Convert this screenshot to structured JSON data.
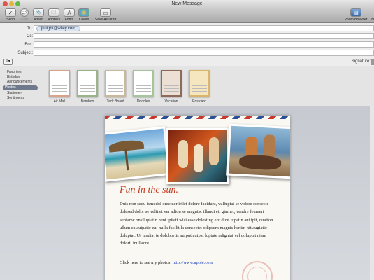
{
  "window": {
    "title": "New Message"
  },
  "toolbar": {
    "buttons": [
      {
        "label": "Send",
        "icon": "send-icon",
        "glyph": "✓"
      },
      {
        "label": "Chat",
        "icon": "chat-icon",
        "glyph": "💬"
      },
      {
        "label": "Attach",
        "icon": "paperclip-icon",
        "glyph": "📎"
      },
      {
        "label": "Address",
        "icon": "address-book-icon",
        "glyph": "📖"
      },
      {
        "label": "Fonts",
        "icon": "fonts-icon",
        "glyph": "A"
      },
      {
        "label": "Colors",
        "icon": "colors-icon",
        "glyph": "●"
      },
      {
        "label": "Save As Draft",
        "icon": "draft-icon",
        "glyph": "▭"
      }
    ],
    "photo_browser": {
      "label": "Photo Browser",
      "icon": "photo-browser-icon",
      "glyph": "▤"
    },
    "clipped_label": "H"
  },
  "header": {
    "to_label": "To:",
    "to_recipient": "jknight@wiley.com",
    "cc_label": "Cc:",
    "bcc_label": "Bcc:",
    "subject_label": "Subject:",
    "format_glyph": "≡▾",
    "signature_label": "Signature:"
  },
  "stationery": {
    "categories": [
      "Favorites",
      "Birthday",
      "Announcements",
      "Photos",
      "Stationery",
      "Sentiments"
    ],
    "selected": "Photos",
    "templates": [
      {
        "name": "Air Mail",
        "color": "#d7a48a"
      },
      {
        "name": "Bamboo",
        "color": "#9bb38a"
      },
      {
        "name": "Tack Board",
        "color": "#c9b89a"
      },
      {
        "name": "Doodles",
        "color": "#a7c59a"
      },
      {
        "name": "Vacation",
        "color": "#8d6b5a"
      },
      {
        "name": "Postcard",
        "color": "#d9b56a"
      }
    ]
  },
  "message": {
    "heading": "Fun in the sun.",
    "paragraph": "Duis non sequ ismodol orectuer irilet dolore facidunt, vulluptat se volore consecte dolesed dolor se velit et ver adion se magnisc illandi eti giamet, vendre feumert aeniamc onsiluptatin hent ipiteti wisi esse dolesting ero dunt utpatin aut ipit, quation ullum ea autpatie eui nulla facilit la consectet odipsum magnis henim nit augiatie doluptat. Ut landiat te dolobortis nulput autpat luptate ndigniat vel doluptat niam dolorti inullaore.",
    "link_prefix": "Click here to see my photos:",
    "link_text": "http://www.apple.com"
  },
  "colors": {
    "accent_title": "#c4391f",
    "link": "#1a3fbf"
  }
}
